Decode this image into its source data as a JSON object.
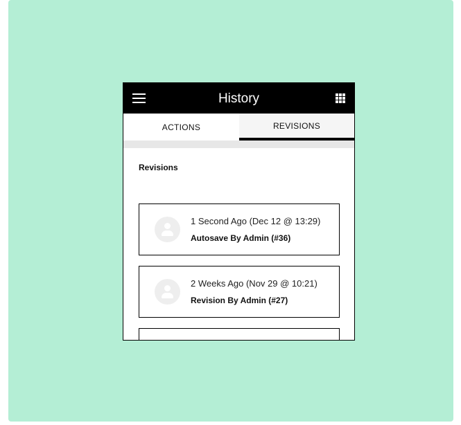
{
  "appbar": {
    "title": "History",
    "menu_icon": "hamburger-menu-icon",
    "apps_icon": "grid-apps-icon"
  },
  "tabs": [
    {
      "label": "ACTIONS",
      "active": false
    },
    {
      "label": "REVISIONS",
      "active": true
    }
  ],
  "section": {
    "heading": "Revisions"
  },
  "revisions": [
    {
      "time": "1 Second Ago (Dec 12 @ 13:29)",
      "title": "Autosave By Admin (#36)",
      "avatar_icon": "user-avatar-icon"
    },
    {
      "time": "2 Weeks Ago (Nov 29 @ 10:21)",
      "title": "Revision By Admin (#27)",
      "avatar_icon": "user-avatar-icon"
    }
  ],
  "colors": {
    "background": "#b4eed5",
    "appbar": "#000000",
    "active_tab_indicator": "#000000"
  }
}
